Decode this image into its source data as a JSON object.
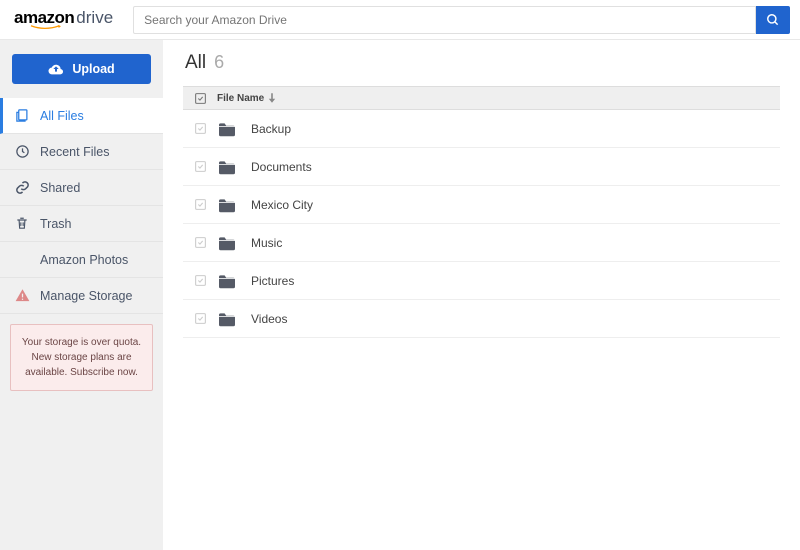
{
  "brand": {
    "main": "amazon",
    "sub": "drive"
  },
  "search": {
    "placeholder": "Search your Amazon Drive"
  },
  "upload": {
    "label": "Upload"
  },
  "sidebar": {
    "items": [
      {
        "label": "All Files",
        "icon": "files"
      },
      {
        "label": "Recent Files",
        "icon": "clock"
      },
      {
        "label": "Shared",
        "icon": "link"
      },
      {
        "label": "Trash",
        "icon": "trash"
      },
      {
        "label": "Amazon Photos",
        "icon": ""
      },
      {
        "label": "Manage Storage",
        "icon": "warning"
      }
    ]
  },
  "quota": {
    "message": "Your storage is over quota. New storage plans are available. Subscribe now."
  },
  "page": {
    "title": "All",
    "count": "6"
  },
  "table": {
    "head": {
      "name": "File Name"
    }
  },
  "files": [
    {
      "name": "Backup"
    },
    {
      "name": "Documents"
    },
    {
      "name": "Mexico City"
    },
    {
      "name": "Music"
    },
    {
      "name": "Pictures"
    },
    {
      "name": "Videos"
    }
  ]
}
